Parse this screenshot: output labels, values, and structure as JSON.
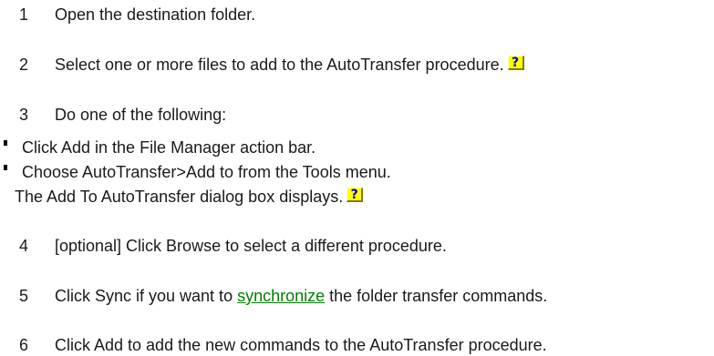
{
  "steps": [
    {
      "number": "1",
      "text": "Open the destination folder."
    },
    {
      "number": "2",
      "text": "Select one or more files to add to the AutoTransfer procedure."
    },
    {
      "number": "3",
      "text": "Do one of the following:"
    },
    {
      "number": "4",
      "text": "[optional] Click Browse to select a different procedure."
    },
    {
      "number": "5",
      "text_before": "Click Sync if you want to ",
      "link": "synchronize",
      "text_after": " the folder transfer commands."
    },
    {
      "number": "6",
      "text": "Click Add to add the new commands to the AutoTransfer procedure."
    }
  ],
  "options": [
    "Click Add in the File Manager action bar.",
    "Choose AutoTransfer>Add to from the Tools menu."
  ],
  "result_note": "The Add To AutoTransfer dialog box displays.",
  "help_icon": {
    "glyph": "?",
    "icon": "help-question-icon",
    "background": "#ffff00",
    "glyph_color": "#0000c0"
  },
  "link_color": "#008000"
}
